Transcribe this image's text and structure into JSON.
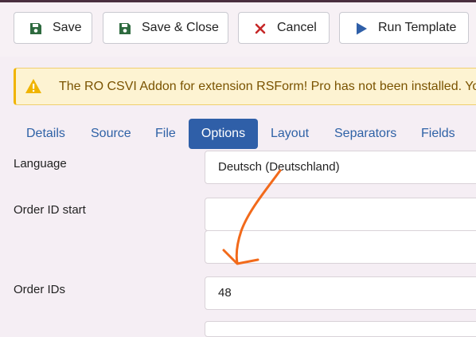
{
  "toolbar": {
    "save_label": "Save",
    "save_close_label": "Save & Close",
    "cancel_label": "Cancel",
    "run_template_label": "Run Template"
  },
  "alert": {
    "message": "The RO CSVI Addon for extension RSForm! Pro has not been installed. You"
  },
  "tabs": [
    {
      "label": "Details",
      "active": false
    },
    {
      "label": "Source",
      "active": false
    },
    {
      "label": "File",
      "active": false
    },
    {
      "label": "Options",
      "active": true
    },
    {
      "label": "Layout",
      "active": false
    },
    {
      "label": "Separators",
      "active": false
    },
    {
      "label": "Fields",
      "active": false
    }
  ],
  "form": {
    "language_label": "Language",
    "language_value": "Deutsch (Deutschland)",
    "order_id_start_label": "Order ID start",
    "order_id_start_value": "",
    "order_id_end_value": "",
    "order_ids_label": "Order IDs",
    "order_ids_value": "48"
  },
  "colors": {
    "tab_active_bg": "#2f5fa8",
    "tab_text": "#2f62a6",
    "save_icon": "#2e6b3f",
    "cancel_icon": "#c62828",
    "run_icon": "#2f5fa8",
    "alert_bg": "#fdf3d2",
    "annotation_arrow": "#f26a1b"
  },
  "icons": {
    "save": "floppy-disk-icon",
    "save_close": "floppy-disk-icon",
    "cancel": "x-icon",
    "run": "play-icon",
    "alert": "warning-triangle-icon"
  }
}
